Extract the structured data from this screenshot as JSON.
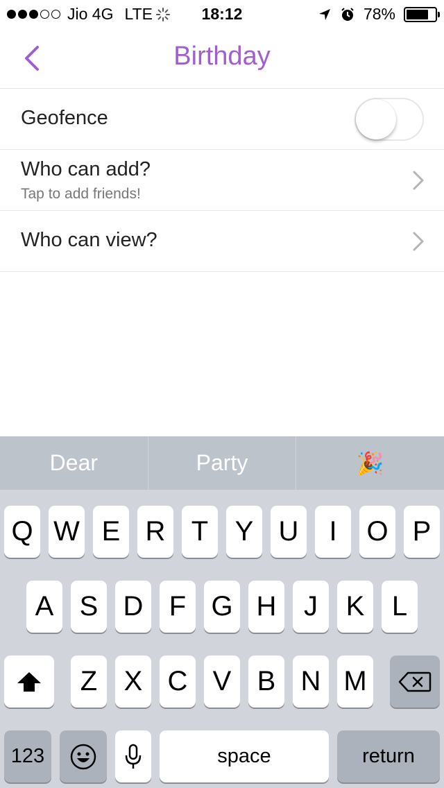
{
  "status_bar": {
    "carrier": "Jio 4G",
    "network": "LTE",
    "time": "18:12",
    "battery_percent": "78%",
    "battery_level": 0.78
  },
  "nav": {
    "title": "Birthday",
    "accent_color": "#a05fd0"
  },
  "settings": {
    "geofence_label": "Geofence",
    "geofence_enabled": false,
    "who_can_add_label": "Who can add?",
    "who_can_add_sub": "Tap to add friends!",
    "who_can_view_label": "Who can view?"
  },
  "keyboard": {
    "predictions": [
      "Dear",
      "Party",
      "🎉"
    ],
    "row1": [
      "Q",
      "W",
      "E",
      "R",
      "T",
      "Y",
      "U",
      "I",
      "O",
      "P"
    ],
    "row2": [
      "A",
      "S",
      "D",
      "F",
      "G",
      "H",
      "J",
      "K",
      "L"
    ],
    "row3": [
      "Z",
      "X",
      "C",
      "V",
      "B",
      "N",
      "M"
    ],
    "numbers_label": "123",
    "space_label": "space",
    "return_label": "return"
  }
}
